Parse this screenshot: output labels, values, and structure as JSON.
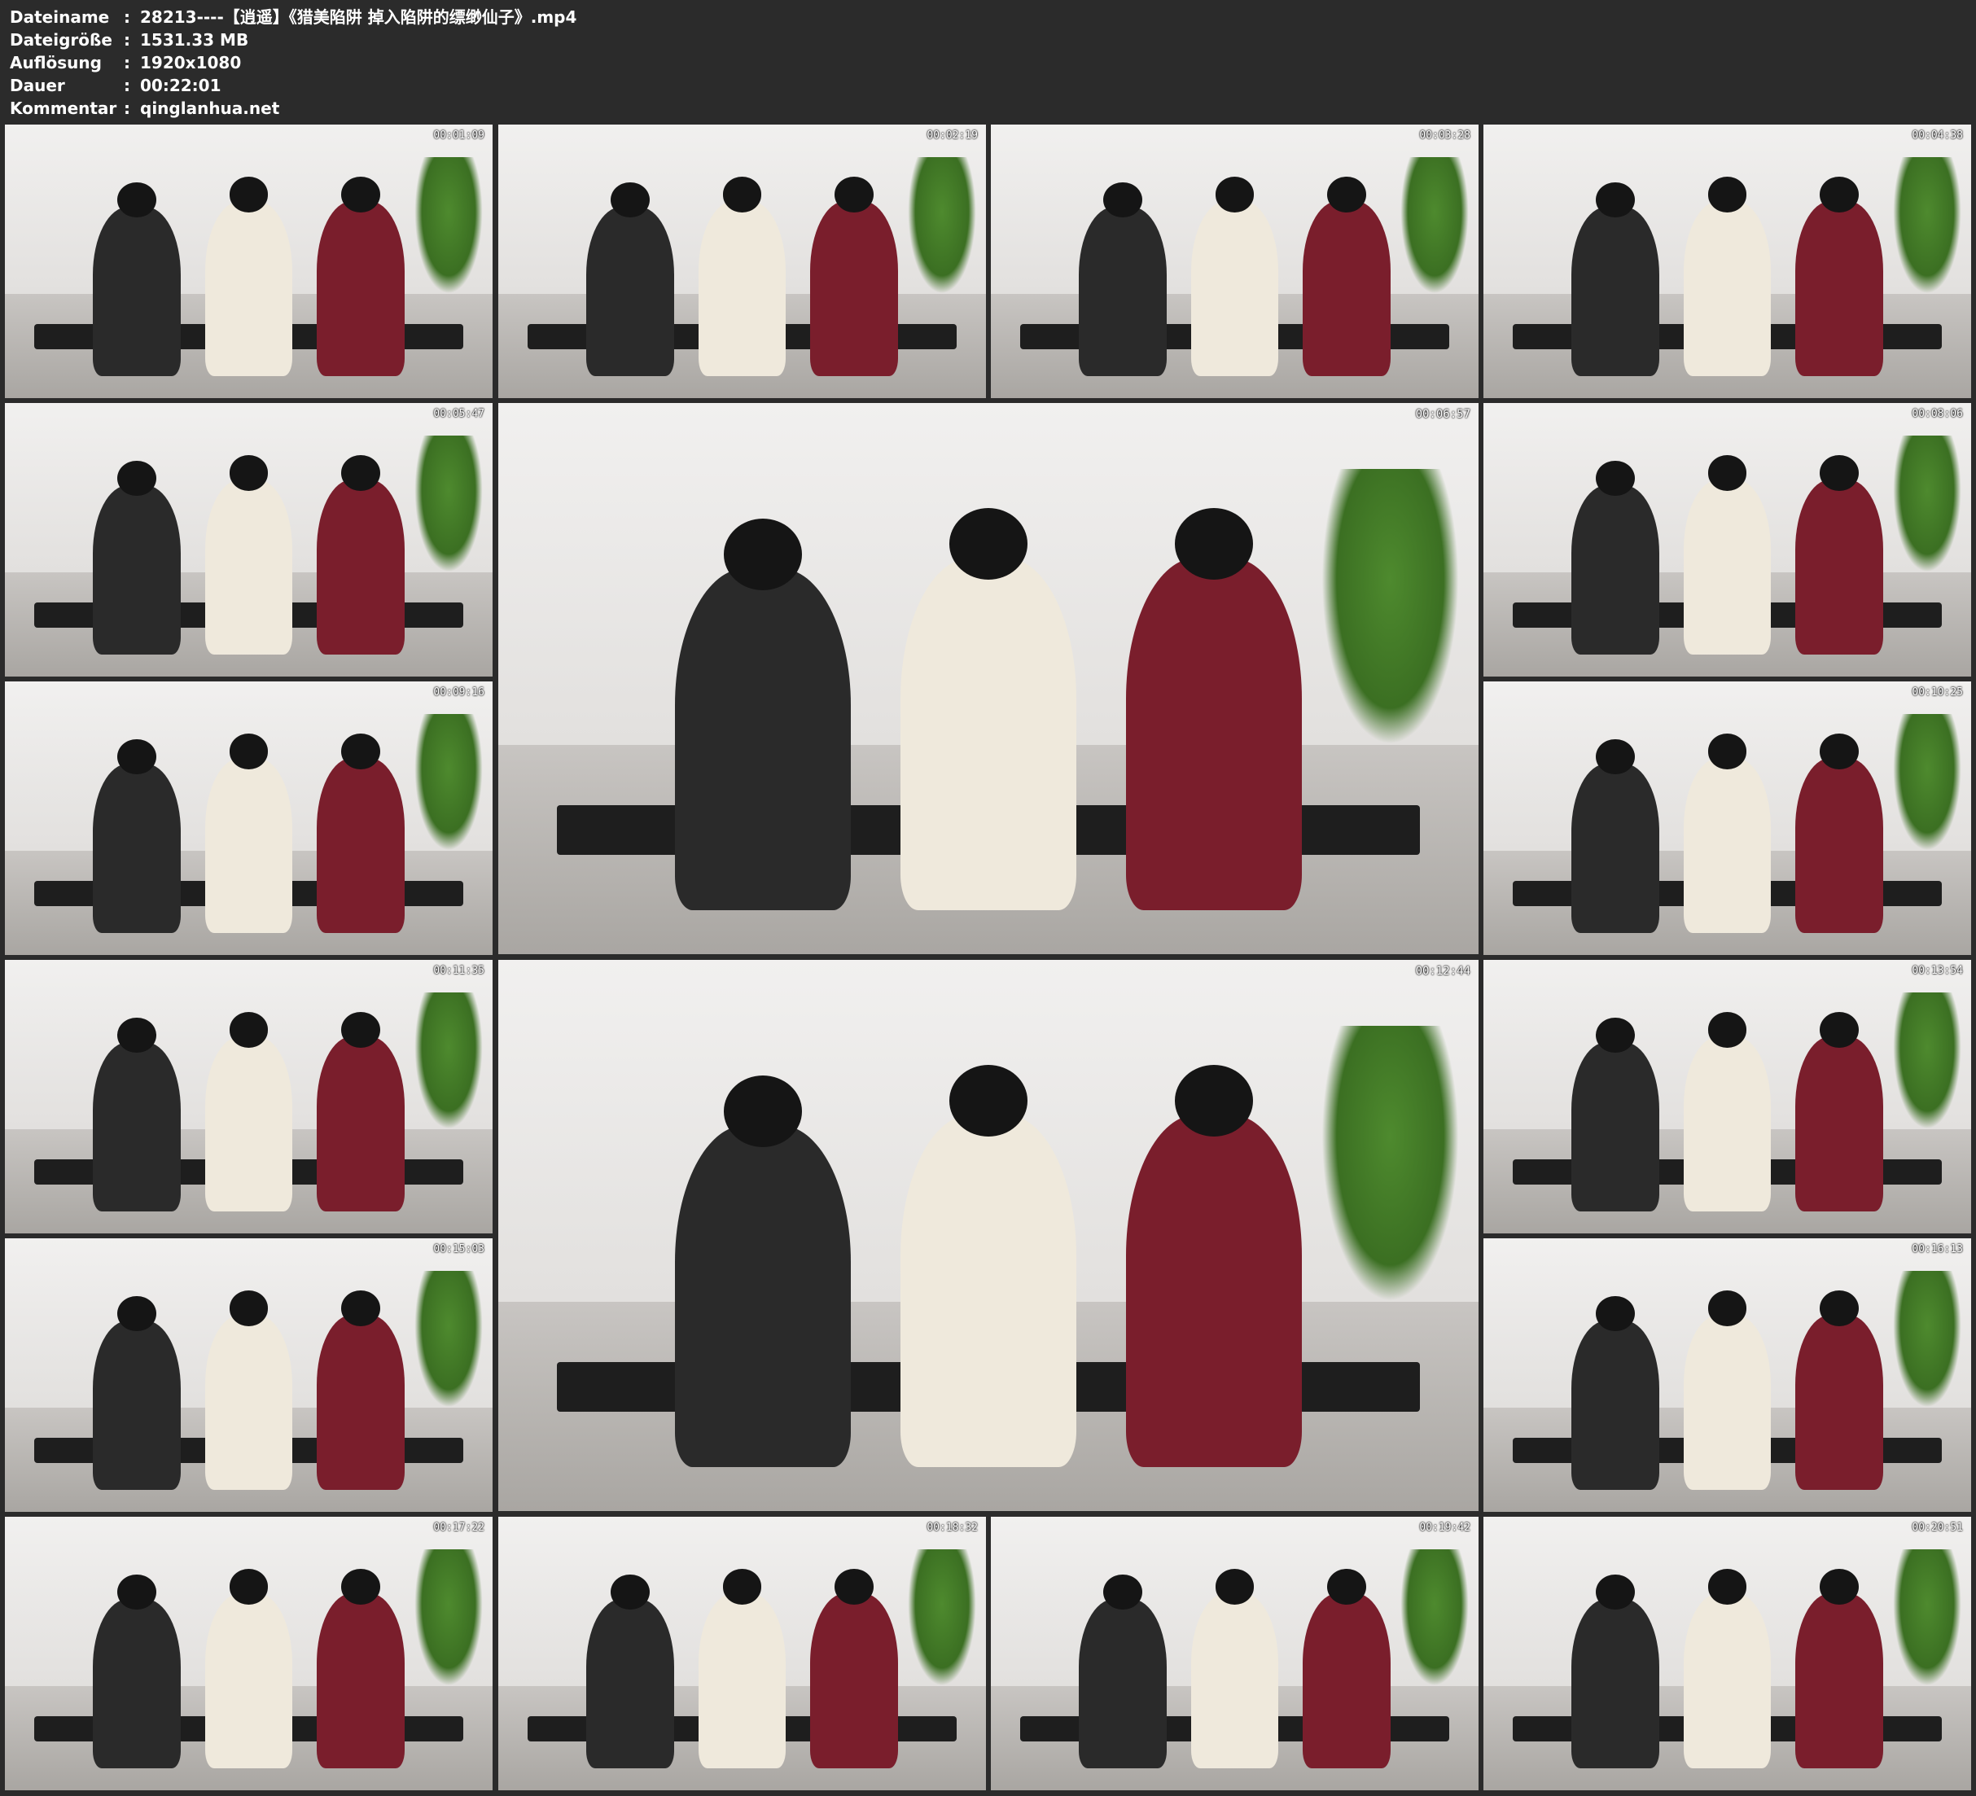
{
  "header": {
    "filename_label": "Dateiname",
    "filename_value": "28213----【逍遥】《猎美陷阱 掉入陷阱的缥缈仙子》.mp4",
    "filesize_label": "Dateigröße",
    "filesize_value": "1531.33 MB",
    "resolution_label": "Auflösung",
    "resolution_value": "1920x1080",
    "duration_label": "Dauer",
    "duration_value": "00:22:01",
    "comment_label": "Kommentar",
    "comment_value": "qinglanhua.net",
    "separator": ":"
  },
  "thumbnails": [
    {
      "timestamp": "00:01:09"
    },
    {
      "timestamp": "00:02:19"
    },
    {
      "timestamp": "00:03:28"
    },
    {
      "timestamp": "00:04:38"
    },
    {
      "timestamp": "00:05:47"
    },
    {
      "timestamp": "00:06:57"
    },
    {
      "timestamp": "00:08:06"
    },
    {
      "timestamp": "00:09:16"
    },
    {
      "timestamp": "00:10:25"
    },
    {
      "timestamp": "00:11:35"
    },
    {
      "timestamp": "00:12:44"
    },
    {
      "timestamp": "00:13:54"
    },
    {
      "timestamp": "00:15:03"
    },
    {
      "timestamp": "00:16:13"
    },
    {
      "timestamp": "00:17:22"
    },
    {
      "timestamp": "00:18:32"
    },
    {
      "timestamp": "00:19:42"
    },
    {
      "timestamp": "00:20:51"
    }
  ]
}
